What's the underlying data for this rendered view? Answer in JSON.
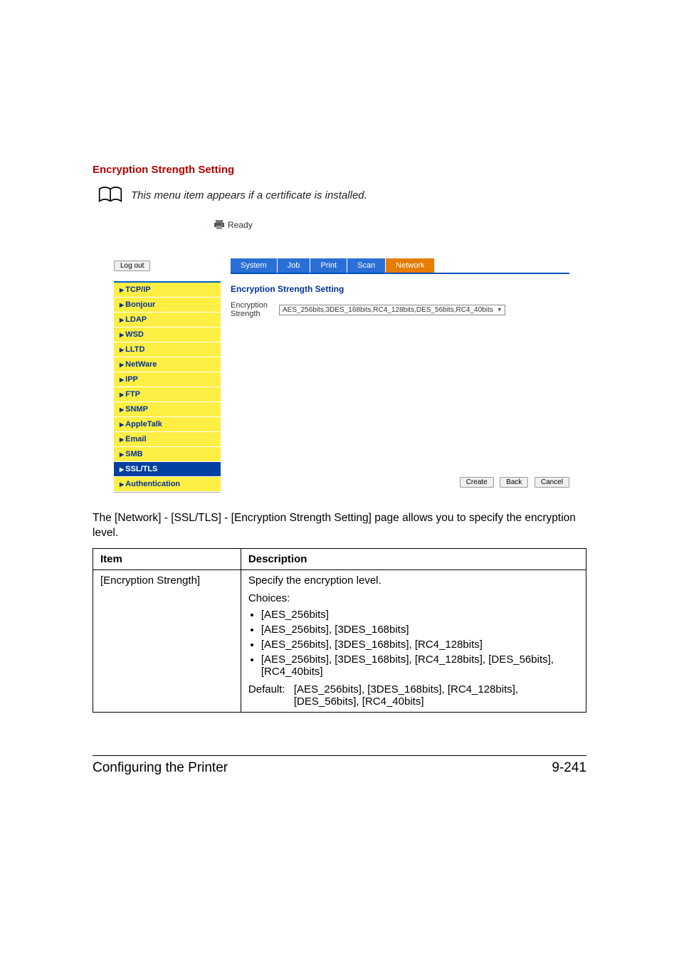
{
  "heading": "Encryption Strength Setting",
  "note": "This menu item appears if a certificate is installed.",
  "embedded_ui": {
    "status_text": "Ready",
    "logout_label": "Log out",
    "sidebar": {
      "items": [
        {
          "label": "TCP/IP",
          "selected": false
        },
        {
          "label": "Bonjour",
          "selected": false
        },
        {
          "label": "LDAP",
          "selected": false
        },
        {
          "label": "WSD",
          "selected": false
        },
        {
          "label": "LLTD",
          "selected": false
        },
        {
          "label": "NetWare",
          "selected": false
        },
        {
          "label": "IPP",
          "selected": false
        },
        {
          "label": "FTP",
          "selected": false
        },
        {
          "label": "SNMP",
          "selected": false
        },
        {
          "label": "AppleTalk",
          "selected": false
        },
        {
          "label": "Email",
          "selected": false
        },
        {
          "label": "SMB",
          "selected": false
        },
        {
          "label": "SSL/TLS",
          "selected": true
        },
        {
          "label": "Authentication",
          "selected": false
        }
      ]
    },
    "tabs": [
      {
        "label": "System",
        "active": false
      },
      {
        "label": "Job",
        "active": false
      },
      {
        "label": "Print",
        "active": false
      },
      {
        "label": "Scan",
        "active": false
      },
      {
        "label": "Network",
        "active": true
      }
    ],
    "panel_title": "Encryption Strength Setting",
    "field_label": "Encryption Strength",
    "field_value": "AES_256bits,3DES_168bits,RC4_128bits,DES_56bits,RC4_40bits",
    "buttons": {
      "create": "Create",
      "back": "Back",
      "cancel": "Cancel"
    }
  },
  "body_paragraph": "The [Network] - [SSL/TLS] - [Encryption Strength Setting] page allows you to specify the encryption level.",
  "table": {
    "head_item": "Item",
    "head_desc": "Description",
    "row_item": "[Encryption Strength]",
    "row_desc_intro": "Specify the encryption level.",
    "choices_label": "Choices:",
    "choices": [
      "[AES_256bits]",
      "[AES_256bits], [3DES_168bits]",
      "[AES_256bits], [3DES_168bits], [RC4_128bits]",
      "[AES_256bits], [3DES_168bits], [RC4_128bits], [DES_56bits], [RC4_40bits]"
    ],
    "default_label": "Default:",
    "default_value": "[AES_256bits], [3DES_168bits], [RC4_128bits], [DES_56bits], [RC4_40bits]"
  },
  "footer": {
    "left": "Configuring the Printer",
    "right": "9-241"
  }
}
